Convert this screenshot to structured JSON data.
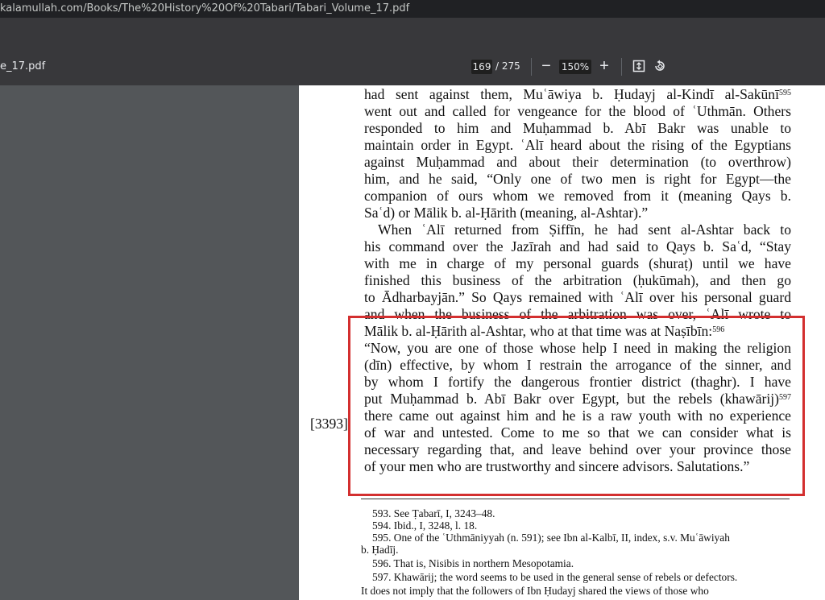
{
  "browser": {
    "url": "kalamullah.com/Books/The%20History%20Of%20Tabari/Tabari_Volume_17.pdf"
  },
  "toolbar": {
    "filename": "e_17.pdf",
    "page_current": "169",
    "page_total_text": "/  275",
    "zoom": "150%",
    "zoom_out_label": "−",
    "zoom_in_label": "+",
    "icons": [
      "minus-icon",
      "plus-icon",
      "fit-page-icon",
      "rotate-icon"
    ]
  },
  "document": {
    "margin_ref": "[3393]",
    "lines": [
      "had sent against them, Muʿāwiya b. Ḥudayj al-Kindī al-Sakūnī",
      "went out and called for vengeance for the blood of ʿUthmān. Others",
      "responded to him and Muḥammad b. Abī Bakr was unable to",
      "maintain order in Egypt. ʿAlī heard about the rising of the Egyptians",
      "against Muḥammad and about their determination (to overthrow)",
      "him, and he said, “Only one of two men is right for Egypt—the",
      "companion of ours whom we removed from it (meaning Qays b.",
      "Saʿd) or Mālik b. al-Ḥārith (meaning, al-Ashtar).”",
      "When ʿAlī returned from Ṣiffīn, he had sent al-Ashtar back to",
      "his command over the Jazīrah and had said to Qays b. Saʿd, “Stay",
      "with me in charge of my personal guards (shuraṭ) until we have",
      "finished this business of the arbitration (ḥukūmah), and then go",
      "to Ādharbayjān.” So Qays remained with ʿAlī over his personal guard",
      "and when the business of the arbitration was over, ʿAlī wrote to",
      "Mālik b. al-Ḥārith al-Ashtar, who at that time was at Naṣībīn:",
      "“Now, you are one of those whose help I need in making the religion",
      "(dīn) effective, by whom I restrain the arrogance of the sinner, and",
      "by whom I fortify the dangerous frontier district (thaghr). I have",
      "put Muḥammad b. Abī Bakr over Egypt, but the rebels (khawārij)",
      "there came out against him and he is a raw youth with no experience",
      "of war and untested. Come to me so that we can consider what is",
      "necessary regarding that, and leave behind over your province those",
      "of your men who are trustworthy and sincere advisors. Salutations.”"
    ],
    "footnote_refs": {
      "l0": "595",
      "l14": "596",
      "l18": "597"
    },
    "footnotes": [
      "593. See Ṭabarī, I, 3243–48.",
      "594. Ibid., I, 3248, l. 18.",
      "595. One of the ʿUthmāniyyah (n. 591); see Ibn al-Kalbī, II, index, s.v. Muʿāwiyah",
      "b. Ḥadīj.",
      "596. That is, Nisibis in northern Mesopotamia.",
      "597. Khawārij; the word seems to be used in the general sense of rebels or defectors.",
      "It does not imply that the followers of Ibn Ḥudayj shared the views of those who"
    ]
  },
  "annotation": {
    "color": "#d32f2f"
  }
}
